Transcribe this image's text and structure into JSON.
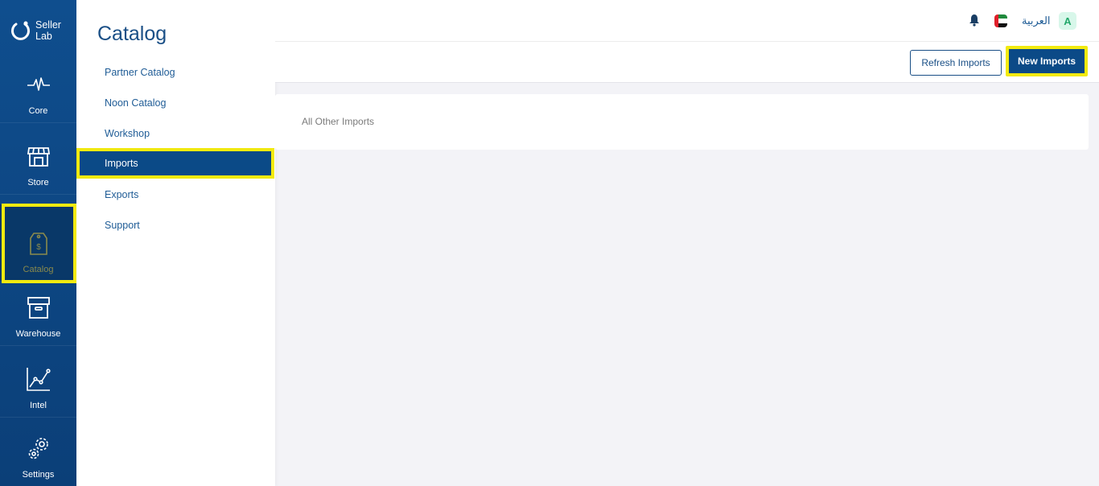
{
  "brand": {
    "name_line1": "Seller",
    "name_line2": "Lab"
  },
  "rail": {
    "items": [
      {
        "label": "Core",
        "icon": "activity-icon"
      },
      {
        "label": "Store",
        "icon": "store-icon"
      },
      {
        "label": "Catalog",
        "icon": "price-tag-icon",
        "active": true
      },
      {
        "label": "Warehouse",
        "icon": "box-icon"
      },
      {
        "label": "Intel",
        "icon": "line-chart-icon"
      },
      {
        "label": "Settings",
        "icon": "gears-icon"
      }
    ]
  },
  "flyout": {
    "title": "Catalog",
    "items": [
      {
        "label": "Partner Catalog"
      },
      {
        "label": "Noon Catalog"
      },
      {
        "label": "Workshop"
      },
      {
        "label": "Imports",
        "active": true
      },
      {
        "label": "Exports"
      },
      {
        "label": "Support"
      }
    ]
  },
  "header": {
    "language": "العربية",
    "avatar_letter": "A",
    "flag": "uae-flag-icon",
    "bell": "bell-icon"
  },
  "actions": {
    "refresh_label": "Refresh Imports",
    "new_label": "New Imports"
  },
  "content": {
    "tab_label": "All Other Imports"
  },
  "colors": {
    "primary": "#0b4a87",
    "highlight": "#f2ea0f",
    "avatar_bg": "#d8f7ea"
  }
}
